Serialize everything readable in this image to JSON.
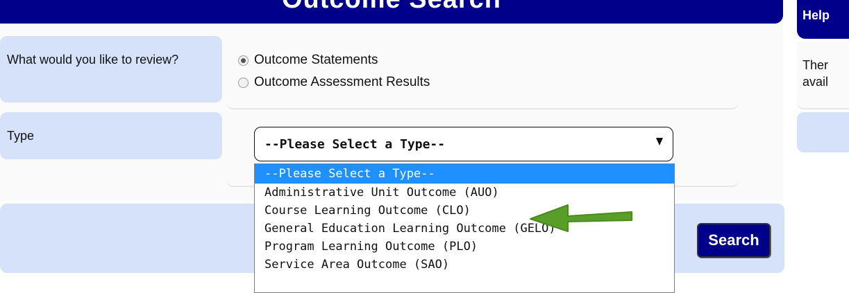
{
  "header": {
    "title": "Outcome Search"
  },
  "form": {
    "review_label": "What would you like to review?",
    "radio_options": [
      "Outcome Statements",
      "Outcome Assessment Results"
    ],
    "selected_radio": 0,
    "type_label": "Type",
    "type_select_value": "--Please Select a Type--",
    "type_options": [
      "--Please Select a Type--",
      "Administrative Unit Outcome (AUO)",
      "Course Learning Outcome (CLO)",
      "General Education Learning Outcome (GELO)",
      "Program Learning Outcome (PLO)",
      "Service Area Outcome (SAO)"
    ]
  },
  "actions": {
    "search_label": "Search"
  },
  "help": {
    "title": "Help",
    "body_line_1": "Ther",
    "body_line_2": "avail"
  },
  "colors": {
    "header_bg": "#00008b",
    "label_bg": "#d6e2fa",
    "highlight": "#1e90ff",
    "arrow": "#5a9e2a"
  }
}
